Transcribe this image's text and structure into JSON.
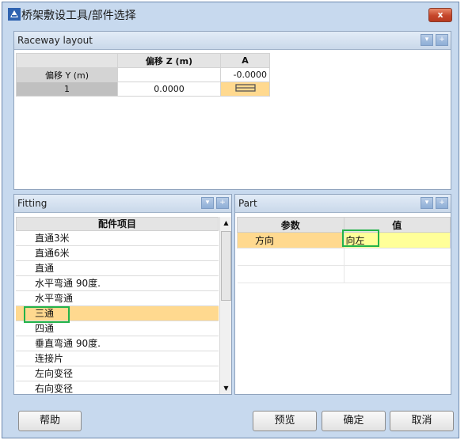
{
  "window": {
    "title": "桥架敷设工具/部件选择",
    "close_label": "x"
  },
  "raceway": {
    "header": "Raceway layout",
    "col_headers": [
      "偏移 Z (m)",
      "A"
    ],
    "row_header_label": "偏移 Y (m)",
    "row_header_value": "-0.0000",
    "row_number": "1",
    "z_value": "0.0000"
  },
  "fitting": {
    "header": "Fitting",
    "column": "配件项目",
    "items": [
      "直通3米",
      "直通6米",
      "直通",
      "水平弯通 90度.",
      "水平弯通",
      "三通",
      "四通",
      "垂直弯通 90度.",
      "连接片",
      "左向变径",
      "右向变径"
    ],
    "selected_index": 5
  },
  "part": {
    "header": "Part",
    "col_param": "参数",
    "col_value": "值",
    "rows": [
      {
        "param": "方向",
        "value": "向左"
      }
    ]
  },
  "buttons": {
    "help": "帮助",
    "preview": "预览",
    "ok": "确定",
    "cancel": "取消"
  }
}
